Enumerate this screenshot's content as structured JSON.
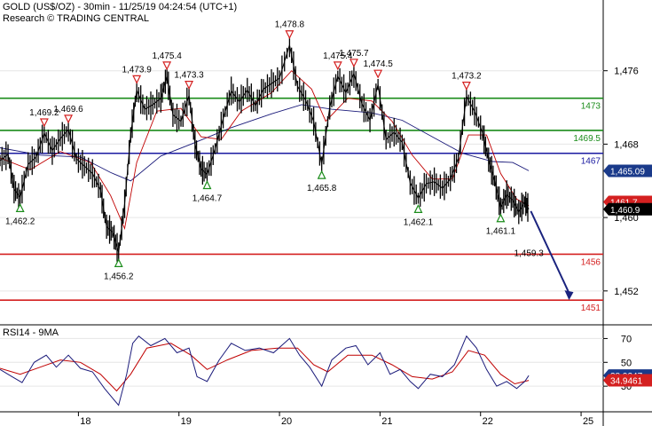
{
  "header": {
    "line1": "GOLD (US$/OZ) - 30min - 11/25/19 04:24:54 (UTC+1)",
    "line2": "Research © TRADING CENTRAL"
  },
  "chart_data": {
    "type": "line",
    "title": "GOLD (US$/OZ) - 30min",
    "price_axis": {
      "ticks": [
        1452,
        1460,
        1468,
        1476
      ],
      "tick_labels": [
        "1,452",
        "1,460",
        "1,468",
        "1,476"
      ],
      "ylim": [
        1448.5,
        1481
      ]
    },
    "x_axis": {
      "xlim": [
        0,
        6.0
      ],
      "ticks": [
        0.78,
        1.78,
        2.78,
        3.78,
        4.78,
        5.78
      ],
      "tick_labels": [
        "18",
        "19",
        "20",
        "21",
        "22",
        "25"
      ]
    },
    "levels": [
      {
        "name": "resistance",
        "value": 1473,
        "label": "1473",
        "color": "#1a8c1a"
      },
      {
        "name": "resistance",
        "value": 1469.5,
        "label": "1469.5",
        "color": "#1a8c1a"
      },
      {
        "name": "pivot",
        "value": 1467,
        "label": "1467",
        "color": "#1a1aa0"
      },
      {
        "name": "support",
        "value": 1456,
        "label": "1456",
        "color": "#d42020"
      },
      {
        "name": "support",
        "value": 1451,
        "label": "1451",
        "color": "#d42020"
      }
    ],
    "price_badges": [
      {
        "value": 1465.09,
        "label": "1,465.09",
        "color": "#1a3a8a"
      },
      {
        "value": 1461.7,
        "label": "1461.7",
        "color": "#d42020"
      },
      {
        "value": 1460.9,
        "label": "1,460.9",
        "color": "#000000"
      }
    ],
    "price_series": [
      [
        0.0,
        1466.2
      ],
      [
        0.08,
        1466.9
      ],
      [
        0.14,
        1463.1
      ],
      [
        0.2,
        1462.2
      ],
      [
        0.28,
        1465.8
      ],
      [
        0.36,
        1466.6
      ],
      [
        0.44,
        1469.2
      ],
      [
        0.52,
        1467.3
      ],
      [
        0.6,
        1468.6
      ],
      [
        0.68,
        1469.6
      ],
      [
        0.76,
        1466.4
      ],
      [
        0.84,
        1465.6
      ],
      [
        0.92,
        1464.8
      ],
      [
        1.0,
        1463.0
      ],
      [
        1.06,
        1459.0
      ],
      [
        1.12,
        1458.4
      ],
      [
        1.18,
        1456.2
      ],
      [
        1.24,
        1461.5
      ],
      [
        1.3,
        1469.0
      ],
      [
        1.36,
        1473.9
      ],
      [
        1.44,
        1471.8
      ],
      [
        1.52,
        1472.3
      ],
      [
        1.6,
        1473.0
      ],
      [
        1.66,
        1475.4
      ],
      [
        1.72,
        1471.2
      ],
      [
        1.8,
        1470.5
      ],
      [
        1.88,
        1473.3
      ],
      [
        1.94,
        1468.0
      ],
      [
        2.0,
        1465.3
      ],
      [
        2.06,
        1464.7
      ],
      [
        2.14,
        1467.5
      ],
      [
        2.22,
        1470.8
      ],
      [
        2.3,
        1473.8
      ],
      [
        2.38,
        1472.6
      ],
      [
        2.46,
        1473.9
      ],
      [
        2.54,
        1472.2
      ],
      [
        2.62,
        1474.0
      ],
      [
        2.7,
        1474.6
      ],
      [
        2.78,
        1475.2
      ],
      [
        2.88,
        1478.8
      ],
      [
        2.96,
        1474.3
      ],
      [
        3.04,
        1472.8
      ],
      [
        3.12,
        1470.5
      ],
      [
        3.2,
        1465.8
      ],
      [
        3.28,
        1472.0
      ],
      [
        3.36,
        1475.4
      ],
      [
        3.44,
        1473.6
      ],
      [
        3.52,
        1475.7
      ],
      [
        3.6,
        1472.4
      ],
      [
        3.68,
        1470.6
      ],
      [
        3.76,
        1474.5
      ],
      [
        3.84,
        1468.5
      ],
      [
        3.92,
        1469.3
      ],
      [
        4.0,
        1468.2
      ],
      [
        4.08,
        1463.8
      ],
      [
        4.16,
        1462.1
      ],
      [
        4.24,
        1463.7
      ],
      [
        4.32,
        1463.9
      ],
      [
        4.4,
        1463.2
      ],
      [
        4.48,
        1464.2
      ],
      [
        4.56,
        1466.5
      ],
      [
        4.64,
        1473.2
      ],
      [
        4.72,
        1471.6
      ],
      [
        4.8,
        1469.2
      ],
      [
        4.86,
        1466.3
      ],
      [
        4.92,
        1464.0
      ],
      [
        4.98,
        1461.1
      ],
      [
        5.04,
        1462.5
      ],
      [
        5.1,
        1461.9
      ],
      [
        5.16,
        1460.6
      ],
      [
        5.22,
        1461.7
      ],
      [
        5.26,
        1460.9
      ]
    ],
    "ma_fast": [
      [
        0.0,
        1466.5
      ],
      [
        0.3,
        1465.2
      ],
      [
        0.6,
        1467.2
      ],
      [
        0.9,
        1466.0
      ],
      [
        1.1,
        1462.4
      ],
      [
        1.24,
        1458.8
      ],
      [
        1.36,
        1466.0
      ],
      [
        1.56,
        1471.6
      ],
      [
        1.8,
        1471.9
      ],
      [
        2.0,
        1468.8
      ],
      [
        2.2,
        1468.5
      ],
      [
        2.4,
        1471.6
      ],
      [
        2.7,
        1473.6
      ],
      [
        2.9,
        1476.0
      ],
      [
        3.1,
        1474.0
      ],
      [
        3.24,
        1470.5
      ],
      [
        3.46,
        1473.0
      ],
      [
        3.7,
        1472.7
      ],
      [
        3.9,
        1470.5
      ],
      [
        4.1,
        1466.8
      ],
      [
        4.3,
        1464.2
      ],
      [
        4.5,
        1464.2
      ],
      [
        4.66,
        1469.0
      ],
      [
        4.84,
        1469.0
      ],
      [
        4.98,
        1464.8
      ],
      [
        5.14,
        1462.0
      ],
      [
        5.26,
        1461.3
      ]
    ],
    "ma_slow": [
      [
        0.0,
        1467.6
      ],
      [
        0.4,
        1466.8
      ],
      [
        0.8,
        1466.6
      ],
      [
        1.1,
        1464.9
      ],
      [
        1.3,
        1464.0
      ],
      [
        1.6,
        1466.7
      ],
      [
        1.9,
        1468.0
      ],
      [
        2.3,
        1469.8
      ],
      [
        2.7,
        1471.3
      ],
      [
        3.0,
        1472.3
      ],
      [
        3.3,
        1471.8
      ],
      [
        3.7,
        1471.4
      ],
      [
        4.0,
        1470.6
      ],
      [
        4.3,
        1468.8
      ],
      [
        4.6,
        1467.0
      ],
      [
        4.9,
        1466.1
      ],
      [
        5.1,
        1466.0
      ],
      [
        5.26,
        1465.1
      ]
    ],
    "annotations": [
      {
        "x": 0.2,
        "value": 1462.2,
        "label": "1,462.2",
        "type": "low"
      },
      {
        "x": 0.44,
        "value": 1469.2,
        "label": "1,469.2",
        "type": "high"
      },
      {
        "x": 0.68,
        "value": 1469.6,
        "label": "1,469.6",
        "type": "high"
      },
      {
        "x": 1.18,
        "value": 1456.2,
        "label": "1,456.2",
        "type": "low"
      },
      {
        "x": 1.36,
        "value": 1473.9,
        "label": "1,473.9",
        "type": "high"
      },
      {
        "x": 1.66,
        "value": 1475.4,
        "label": "1,475.4",
        "type": "high"
      },
      {
        "x": 1.88,
        "value": 1473.3,
        "label": "1,473.3",
        "type": "high"
      },
      {
        "x": 2.06,
        "value": 1464.7,
        "label": "1,464.7",
        "type": "low"
      },
      {
        "x": 2.88,
        "value": 1478.8,
        "label": "1,478.8",
        "type": "high"
      },
      {
        "x": 3.2,
        "value": 1465.8,
        "label": "1,465.8",
        "type": "low"
      },
      {
        "x": 3.36,
        "value": 1475.4,
        "label": "1,475.4",
        "type": "high"
      },
      {
        "x": 3.52,
        "value": 1475.7,
        "label": "1,475.7",
        "type": "high"
      },
      {
        "x": 3.76,
        "value": 1474.5,
        "label": "1,474.5",
        "type": "high"
      },
      {
        "x": 4.16,
        "value": 1462.1,
        "label": "1,462.1",
        "type": "low"
      },
      {
        "x": 4.64,
        "value": 1473.2,
        "label": "1,473.2",
        "type": "high"
      },
      {
        "x": 4.98,
        "value": 1461.1,
        "label": "1,461.1",
        "type": "low"
      },
      {
        "x": 5.26,
        "value": 1459.3,
        "label": "1,459.3",
        "type": "projection"
      }
    ],
    "forecast_arrow": {
      "from": [
        5.28,
        1460.7
      ],
      "to": [
        5.66,
        1451.0
      ],
      "color": "#1a237e"
    },
    "rsi": {
      "label": "RSI14 - 9MA",
      "ylim": [
        10,
        80
      ],
      "ticks": [
        30,
        50,
        70
      ],
      "tick_labels": [
        "30",
        "50",
        "70"
      ],
      "badges": [
        {
          "value": 38.9247,
          "label": "38.9247",
          "color": "#1a3a8a"
        },
        {
          "value": 34.9461,
          "label": "34.9461",
          "color": "#d42020"
        }
      ],
      "rsi_series": [
        [
          0.0,
          44
        ],
        [
          0.12,
          38
        ],
        [
          0.22,
          33
        ],
        [
          0.34,
          50
        ],
        [
          0.46,
          56
        ],
        [
          0.56,
          46
        ],
        [
          0.68,
          56
        ],
        [
          0.8,
          45
        ],
        [
          0.92,
          42
        ],
        [
          1.04,
          28
        ],
        [
          1.12,
          20
        ],
        [
          1.18,
          14
        ],
        [
          1.26,
          40
        ],
        [
          1.32,
          66
        ],
        [
          1.38,
          72
        ],
        [
          1.5,
          64
        ],
        [
          1.64,
          70
        ],
        [
          1.76,
          58
        ],
        [
          1.88,
          62
        ],
        [
          1.96,
          38
        ],
        [
          2.06,
          34
        ],
        [
          2.18,
          52
        ],
        [
          2.3,
          66
        ],
        [
          2.44,
          60
        ],
        [
          2.58,
          62
        ],
        [
          2.72,
          58
        ],
        [
          2.88,
          70
        ],
        [
          2.98,
          56
        ],
        [
          3.08,
          46
        ],
        [
          3.2,
          30
        ],
        [
          3.3,
          52
        ],
        [
          3.44,
          62
        ],
        [
          3.54,
          64
        ],
        [
          3.66,
          48
        ],
        [
          3.78,
          58
        ],
        [
          3.88,
          40
        ],
        [
          3.98,
          44
        ],
        [
          4.08,
          34
        ],
        [
          4.16,
          28
        ],
        [
          4.28,
          40
        ],
        [
          4.4,
          38
        ],
        [
          4.52,
          48
        ],
        [
          4.64,
          72
        ],
        [
          4.74,
          62
        ],
        [
          4.84,
          44
        ],
        [
          4.94,
          30
        ],
        [
          5.04,
          34
        ],
        [
          5.14,
          28
        ],
        [
          5.22,
          34
        ],
        [
          5.26,
          38.9
        ]
      ],
      "ma_series": [
        [
          0.0,
          45
        ],
        [
          0.2,
          40
        ],
        [
          0.4,
          46
        ],
        [
          0.6,
          52
        ],
        [
          0.8,
          50
        ],
        [
          1.0,
          40
        ],
        [
          1.16,
          26
        ],
        [
          1.3,
          40
        ],
        [
          1.46,
          62
        ],
        [
          1.7,
          66
        ],
        [
          1.9,
          56
        ],
        [
          2.06,
          44
        ],
        [
          2.26,
          52
        ],
        [
          2.5,
          60
        ],
        [
          2.76,
          62
        ],
        [
          2.96,
          62
        ],
        [
          3.12,
          48
        ],
        [
          3.26,
          42
        ],
        [
          3.46,
          56
        ],
        [
          3.7,
          56
        ],
        [
          3.9,
          48
        ],
        [
          4.1,
          38
        ],
        [
          4.3,
          36
        ],
        [
          4.5,
          42
        ],
        [
          4.66,
          60
        ],
        [
          4.82,
          56
        ],
        [
          4.98,
          40
        ],
        [
          5.12,
          32
        ],
        [
          5.26,
          34.9
        ]
      ]
    }
  }
}
